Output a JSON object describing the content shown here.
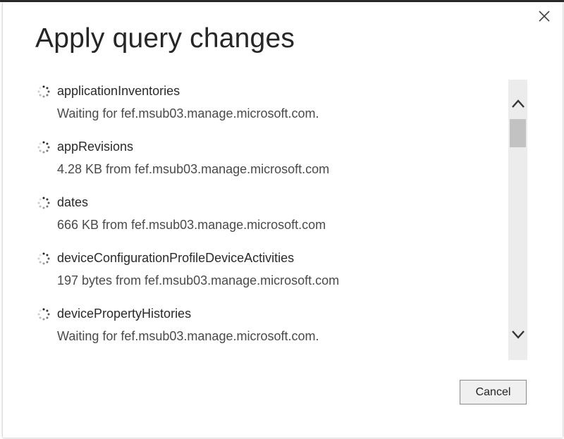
{
  "dialog": {
    "title": "Apply query changes",
    "close_icon": "close-icon",
    "cancel_label": "Cancel"
  },
  "queries": [
    {
      "name": "applicationInventories",
      "status": "Waiting for fef.msub03.manage.microsoft.com."
    },
    {
      "name": "appRevisions",
      "status": "4.28 KB from fef.msub03.manage.microsoft.com"
    },
    {
      "name": "dates",
      "status": "666 KB from fef.msub03.manage.microsoft.com"
    },
    {
      "name": "deviceConfigurationProfileDeviceActivities",
      "status": "197 bytes from fef.msub03.manage.microsoft.com"
    },
    {
      "name": "devicePropertyHistories",
      "status": "Waiting for fef.msub03.manage.microsoft.com."
    }
  ],
  "scrollbar": {
    "up_icon": "chevron-up-icon",
    "down_icon": "chevron-down-icon"
  },
  "colors": {
    "scroll_track": "#ececec",
    "scroll_thumb": "#c2c2c2",
    "button_bg": "#f0f0f0"
  }
}
